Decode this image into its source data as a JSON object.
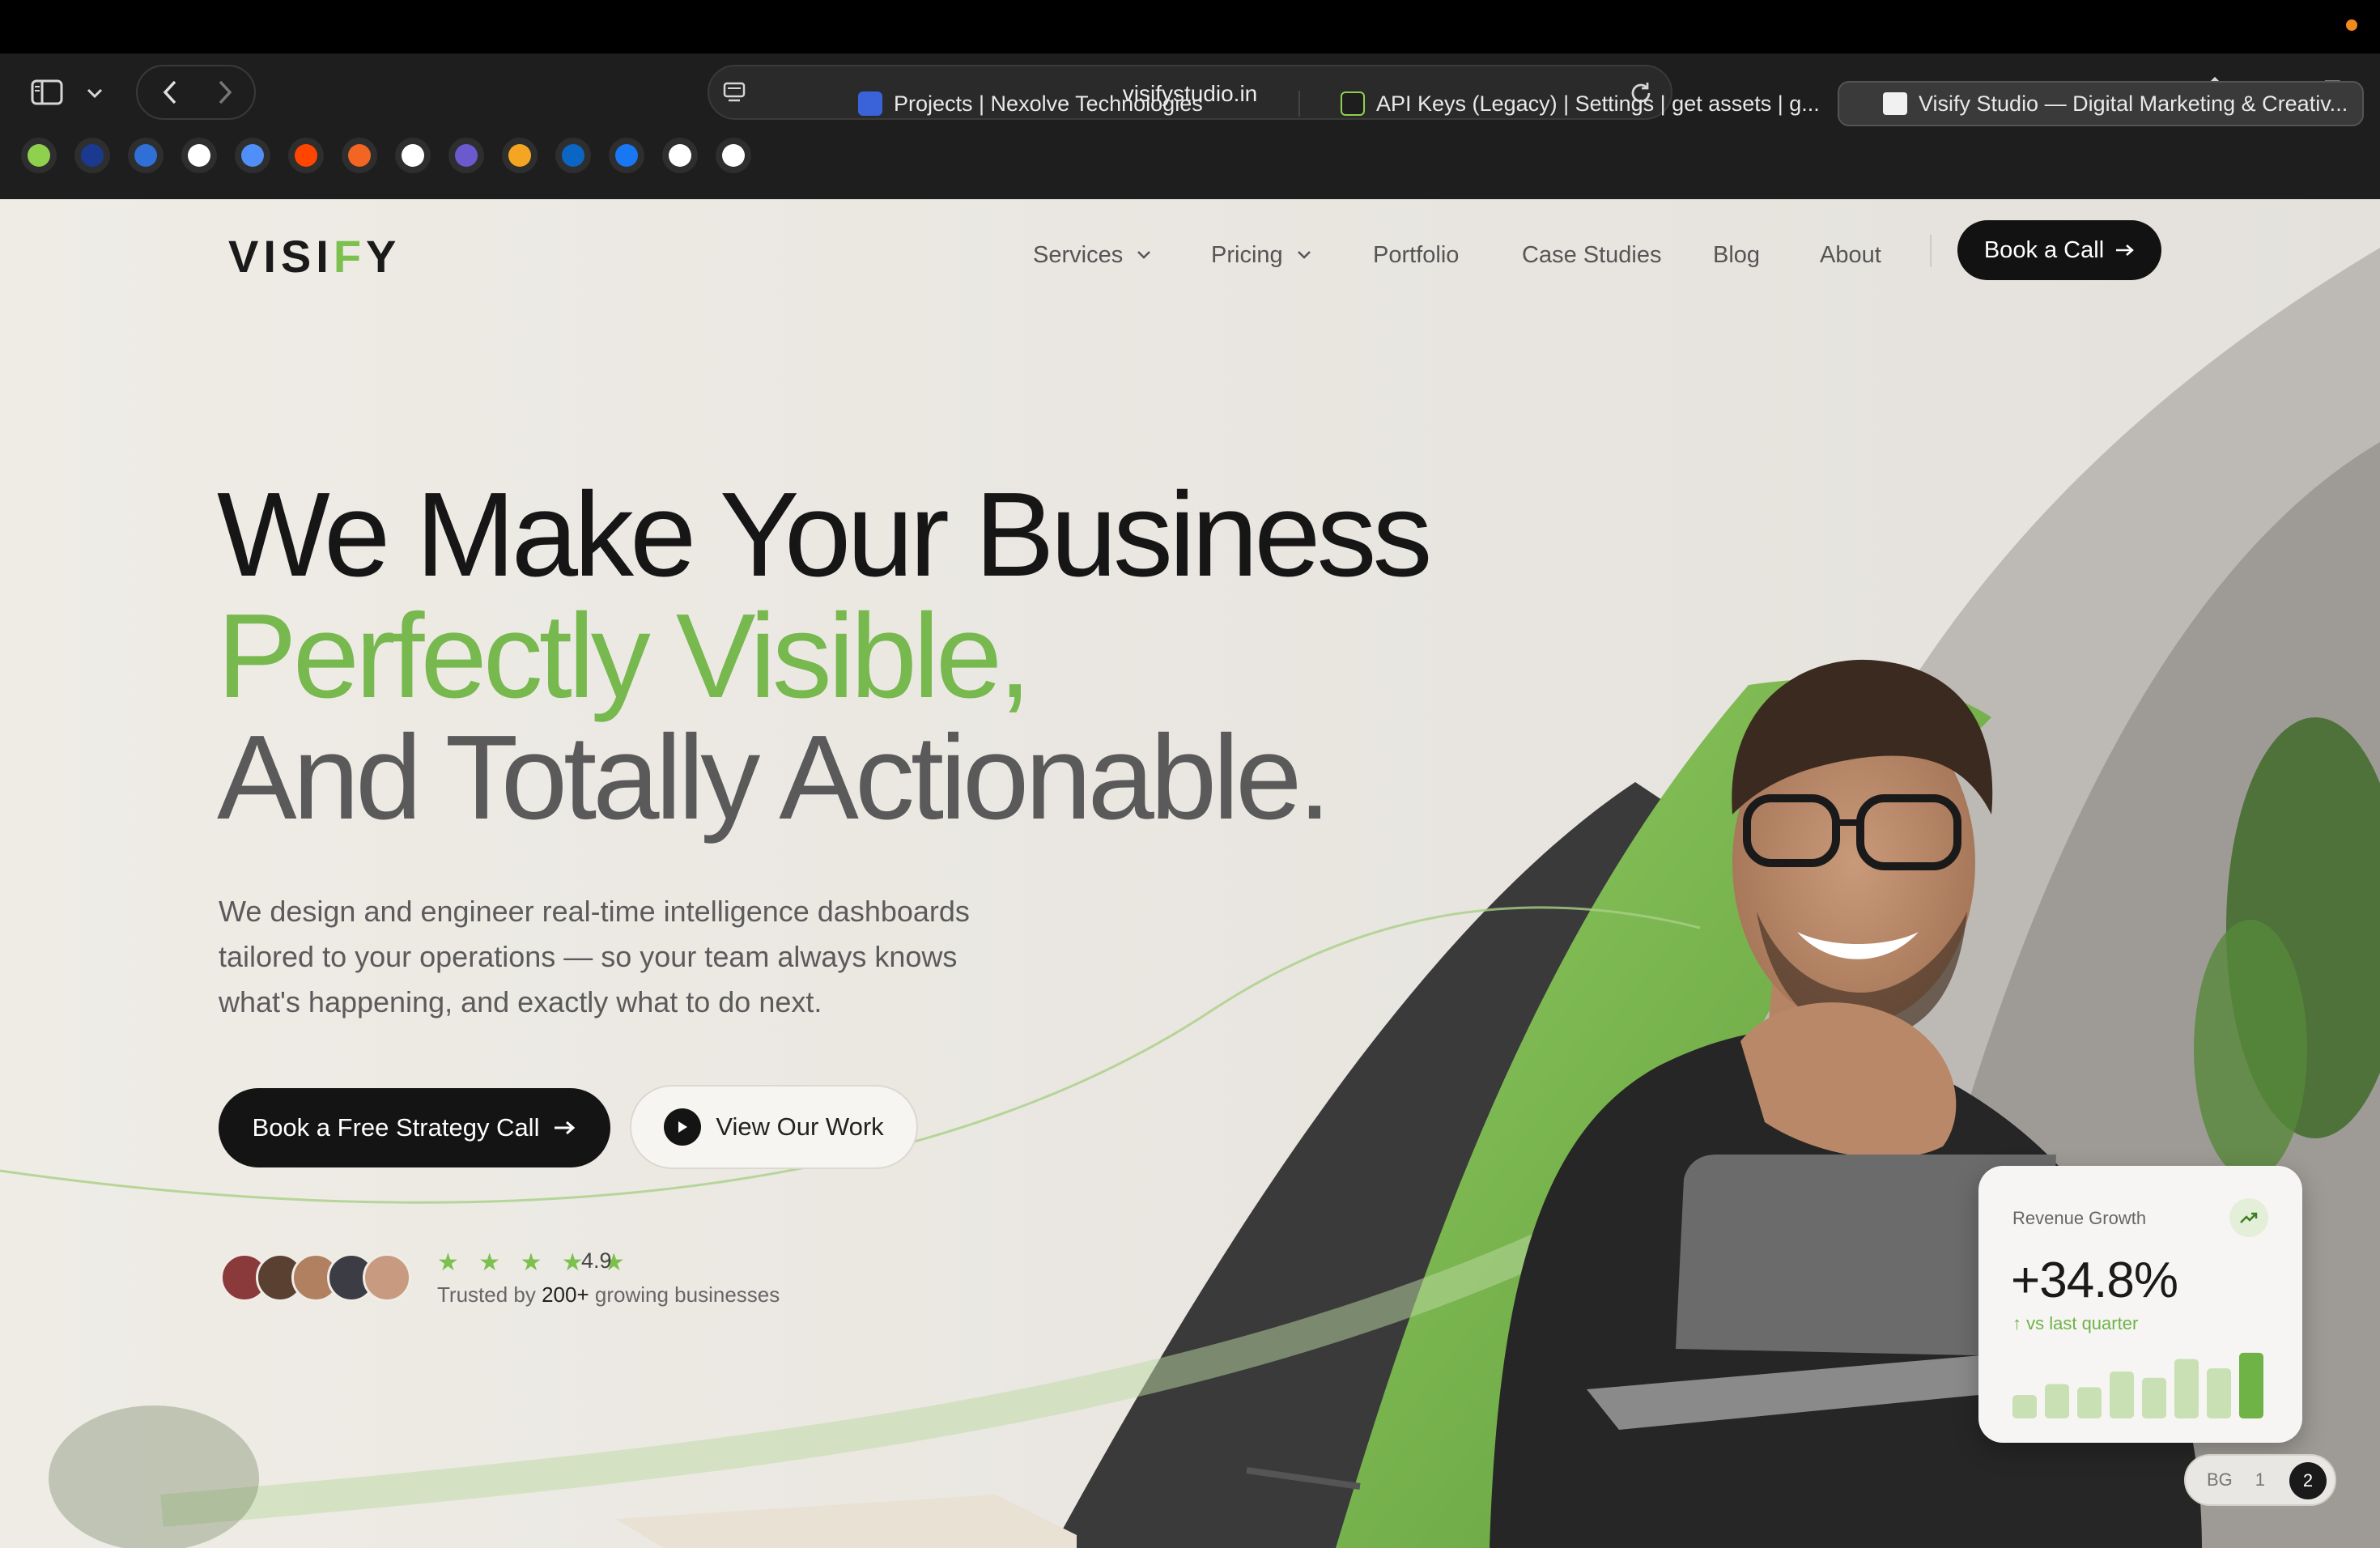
{
  "browser": {
    "url": "visifystudio.in",
    "bookmarks": [
      {
        "icon": "green-swirl-icon",
        "color": "#8fd14f"
      },
      {
        "icon": "paypal-icon",
        "color": "#1a3a8f"
      },
      {
        "icon": "blue-slash-icon",
        "color": "#2f6fd6"
      },
      {
        "icon": "openai-icon",
        "color": "#ffffff"
      },
      {
        "icon": "gemini-icon",
        "color": "#4f8ff7"
      },
      {
        "icon": "reddit-icon",
        "color": "#ff4500"
      },
      {
        "icon": "ycombinator-icon",
        "color": "#f26522"
      },
      {
        "icon": "triangle-icon",
        "color": "#ffffff"
      },
      {
        "icon": "purple-save-icon",
        "color": "#6a5acd"
      },
      {
        "icon": "analytics-icon",
        "color": "#f4a623"
      },
      {
        "icon": "linkedin-icon",
        "color": "#0a66c2"
      },
      {
        "icon": "facebook-icon",
        "color": "#1877f2"
      },
      {
        "icon": "medium-icon",
        "color": "#ffffff"
      },
      {
        "icon": "buffer-icon",
        "color": "#ffffff"
      }
    ],
    "tabs": [
      {
        "title": "Projects | Nexolve Technologies",
        "active": false
      },
      {
        "title": "API Keys (Legacy) | Settings | get assets | g...",
        "active": false
      },
      {
        "title": "Visify Studio — Digital Marketing & Creativ...",
        "active": true
      }
    ]
  },
  "site": {
    "logo_pre": "VISI",
    "logo_f": "F",
    "logo_post": "Y",
    "nav": {
      "services": "Services",
      "pricing": "Pricing",
      "portfolio": "Portfolio",
      "case_studies": "Case Studies",
      "blog": "Blog",
      "about": "About",
      "cta": "Book a Call"
    },
    "hero": {
      "line1": "We Make Your Business",
      "line2": "Perfectly Visible,",
      "line3": "And Totally Actionable.",
      "subtitle": "We design and engineer real-time intelligence dashboards tailored to your operations — so your team always knows what's happening, and exactly what to do next.",
      "primary_cta": "Book a Free Strategy Call",
      "secondary_cta": "View Our Work",
      "stars": "★ ★ ★ ★ ★",
      "rating": "4.9",
      "trusted_pre": "Trusted by ",
      "trusted_num": "200+",
      "trusted_post": " growing businesses"
    },
    "revenue_card": {
      "title": "Revenue Growth",
      "value": "+34.8%",
      "delta": "↑ vs last quarter",
      "bar_levels": [
        0.15,
        0.22,
        0.2,
        0.3,
        0.26,
        0.38,
        0.32,
        0.42
      ]
    },
    "pager": {
      "bg": "BG",
      "one": "1",
      "two": "2"
    },
    "colors": {
      "accent": "#7cc04f",
      "dark": "#141414",
      "bg": "#efece6"
    }
  }
}
